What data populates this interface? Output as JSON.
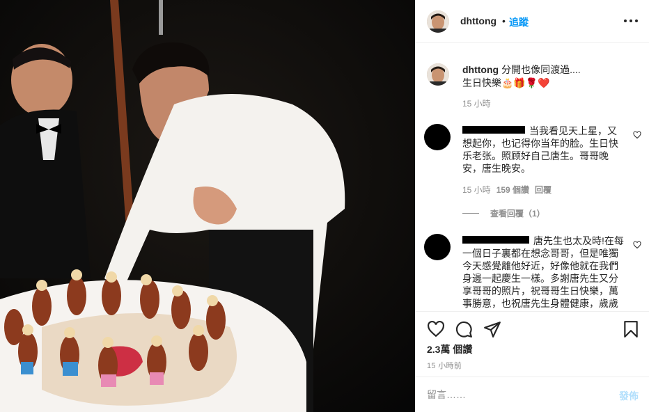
{
  "header": {
    "username": "dhttong",
    "separator": "•",
    "follow_label": "追蹤"
  },
  "caption": {
    "username": "dhttong",
    "line1": "分開也像同渡過....",
    "line2": "生日快樂🎂🎁🌹❤️",
    "time": "15 小時"
  },
  "comments": [
    {
      "text": "当我看见天上星，又想起你，也记得你当年的脸。生日快乐老张。照顾好自己唐生。哥哥晚安，唐生晚安。",
      "time": "15 小時",
      "likes": "159 個讚",
      "reply_label": "回覆",
      "view_replies": "查看回覆（1）"
    },
    {
      "text": "唐先生也太及時!在每一個日子裏都在想念哥哥，但是唯獨今天感覺離他好近，好像他就在我們身邊一起慶生一樣。多謝唐先生又分享哥哥的照片，祝哥哥生日快樂，萬事勝意，也祝唐先生身體健康，歲歲"
    }
  ],
  "actions": {
    "like_icon": "heart-icon",
    "comment_icon": "comment-icon",
    "share_icon": "paper-plane-icon",
    "save_icon": "bookmark-icon",
    "views": "2.3萬 個讚",
    "posted": "15 小時前"
  },
  "add_comment": {
    "placeholder": "留言……",
    "post_label": "發佈"
  },
  "colors": {
    "link_blue": "#0095f6",
    "post_disabled": "#b2dffc",
    "muted": "#8e8e8e"
  }
}
